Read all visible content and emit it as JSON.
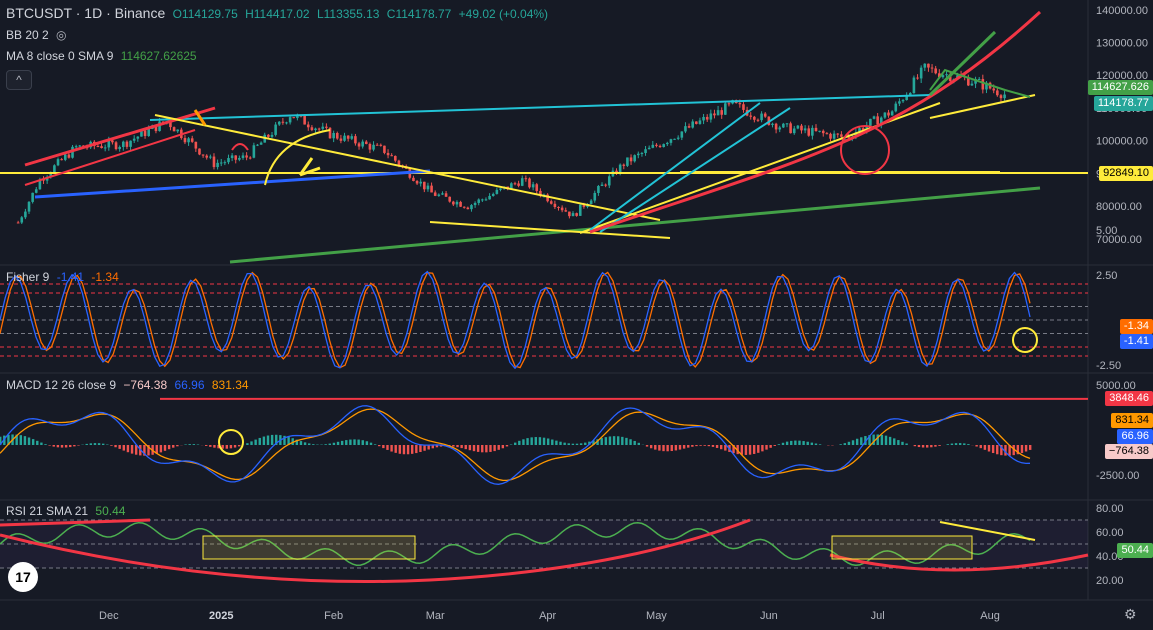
{
  "header": {
    "symbol": "BTCUSDT · 1D · Binance",
    "open": "O114129.75",
    "high": "H114417.02",
    "low": "L113355.13",
    "close": "C114178.77",
    "change": "+49.02 (+0.04%)",
    "bb": "BB 20 2",
    "ma": "MA 8 close 0 SMA 9",
    "ma_value": "114627.62625",
    "collapse_label": "^"
  },
  "fisher_legend": {
    "name": "Fisher 9",
    "v1": "-1.41",
    "v2": "-1.34"
  },
  "macd_legend": {
    "name": "MACD 12 26 close 9",
    "hist": "−764.38",
    "macd": "66.96",
    "signal": "831.34"
  },
  "rsi_legend": {
    "name": "RSI 21 SMA 21",
    "value": "50.44"
  },
  "price_tags": {
    "ma": "114627.626",
    "close": "114178.77",
    "support": "92849.10",
    "fisher1": "-1.34",
    "fisher2": "-1.41",
    "macd_level": "3848.46",
    "macd_signal": "831.34",
    "macd_line": "66.96",
    "macd_hist": "−764.38",
    "rsi": "50.44"
  },
  "colors": {
    "background": "#161a25",
    "bull": "#26a69a",
    "bear": "#ef5350",
    "yellow": "#ffeb3b",
    "red_line": "#f23645",
    "cyan": "#22c3d6",
    "blue": "#2962ff",
    "green": "#43a047",
    "fisher_blue": "#2962ff",
    "fisher_orange": "#ff6d00",
    "macd_blue": "#2962ff",
    "macd_orange": "#ff9800",
    "rsi": "#4caf50"
  },
  "chart_data": [
    {
      "type": "candlestick",
      "title": "BTCUSDT · 1D · Binance",
      "x_ticks": [
        "Dec",
        "2025",
        "Feb",
        "Mar",
        "Apr",
        "May",
        "Jun",
        "Jul",
        "Aug"
      ],
      "y_ticks": [
        70000,
        80000,
        90000,
        100000,
        110000,
        120000,
        130000,
        140000
      ],
      "ylim": [
        62000,
        143000
      ],
      "close_series": [
        {
          "date": "2024-11-06",
          "close": 75000
        },
        {
          "date": "2024-11-12",
          "close": 88000
        },
        {
          "date": "2024-11-22",
          "close": 98000
        },
        {
          "date": "2024-12-05",
          "close": 99000
        },
        {
          "date": "2024-12-17",
          "close": 106000
        },
        {
          "date": "2024-12-30",
          "close": 93000
        },
        {
          "date": "2025-01-08",
          "close": 95000
        },
        {
          "date": "2025-01-20",
          "close": 108000
        },
        {
          "date": "2025-01-31",
          "close": 102000
        },
        {
          "date": "2025-02-15",
          "close": 97000
        },
        {
          "date": "2025-02-28",
          "close": 84000
        },
        {
          "date": "2025-03-10",
          "close": 80000
        },
        {
          "date": "2025-03-25",
          "close": 88000
        },
        {
          "date": "2025-04-08",
          "close": 77000
        },
        {
          "date": "2025-04-22",
          "close": 93000
        },
        {
          "date": "2025-05-10",
          "close": 104000
        },
        {
          "date": "2025-05-22",
          "close": 111000
        },
        {
          "date": "2025-06-05",
          "close": 104000
        },
        {
          "date": "2025-06-22",
          "close": 101000
        },
        {
          "date": "2025-07-05",
          "close": 109000
        },
        {
          "date": "2025-07-14",
          "close": 122000
        },
        {
          "date": "2025-07-28",
          "close": 118000
        },
        {
          "date": "2025-08-05",
          "close": 114178.77
        }
      ],
      "levels": [
        {
          "label": "92849.10",
          "value": 92849.1
        }
      ]
    },
    {
      "type": "line",
      "title": "Fisher 9",
      "y_ticks": [
        2.5,
        -2.5,
        5.0
      ],
      "ylim": [
        -5,
        5
      ],
      "series": [
        {
          "name": "Fisher",
          "last": -1.41
        },
        {
          "name": "Trigger",
          "last": -1.34
        }
      ],
      "levels": [
        2.0,
        1.5,
        0.75,
        0,
        -0.75,
        -1.5,
        -2.0
      ]
    },
    {
      "type": "line",
      "title": "MACD 12 26 close 9",
      "y_ticks": [
        5000,
        -2500
      ],
      "series": [
        {
          "name": "Histogram",
          "last": -764.38
        },
        {
          "name": "MACD",
          "last": 66.96
        },
        {
          "name": "Signal",
          "last": 831.34
        }
      ],
      "levels": [
        3848.46
      ]
    },
    {
      "type": "line",
      "title": "RSI 21 SMA 21",
      "y_ticks": [
        80,
        60,
        40,
        20
      ],
      "ylim": [
        18,
        84
      ],
      "series": [
        {
          "name": "RSI",
          "last": 50.44
        }
      ],
      "bands": [
        30,
        50,
        70
      ]
    }
  ]
}
